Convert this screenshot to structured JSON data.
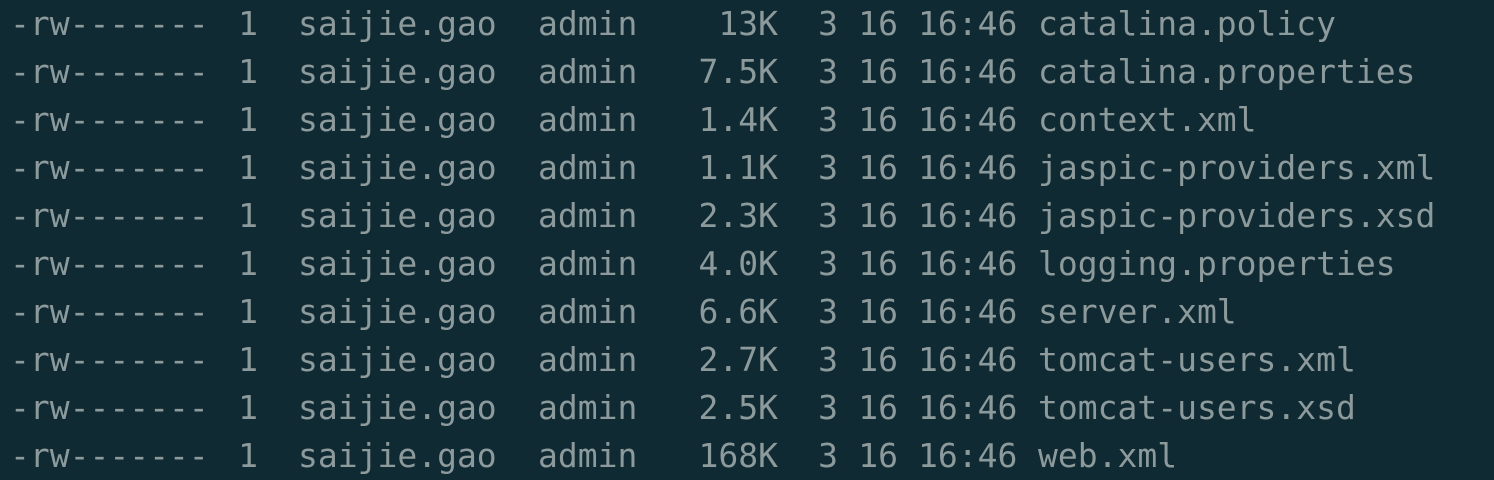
{
  "terminal": {
    "rows": [
      {
        "perm": "-rw-------",
        "links": "1",
        "owner": "saijie.gao",
        "group": "admin",
        "size": "13K",
        "month": "3",
        "day": "16",
        "time": "16:46",
        "name": "catalina.policy"
      },
      {
        "perm": "-rw-------",
        "links": "1",
        "owner": "saijie.gao",
        "group": "admin",
        "size": "7.5K",
        "month": "3",
        "day": "16",
        "time": "16:46",
        "name": "catalina.properties"
      },
      {
        "perm": "-rw-------",
        "links": "1",
        "owner": "saijie.gao",
        "group": "admin",
        "size": "1.4K",
        "month": "3",
        "day": "16",
        "time": "16:46",
        "name": "context.xml"
      },
      {
        "perm": "-rw-------",
        "links": "1",
        "owner": "saijie.gao",
        "group": "admin",
        "size": "1.1K",
        "month": "3",
        "day": "16",
        "time": "16:46",
        "name": "jaspic-providers.xml"
      },
      {
        "perm": "-rw-------",
        "links": "1",
        "owner": "saijie.gao",
        "group": "admin",
        "size": "2.3K",
        "month": "3",
        "day": "16",
        "time": "16:46",
        "name": "jaspic-providers.xsd"
      },
      {
        "perm": "-rw-------",
        "links": "1",
        "owner": "saijie.gao",
        "group": "admin",
        "size": "4.0K",
        "month": "3",
        "day": "16",
        "time": "16:46",
        "name": "logging.properties"
      },
      {
        "perm": "-rw-------",
        "links": "1",
        "owner": "saijie.gao",
        "group": "admin",
        "size": "6.6K",
        "month": "3",
        "day": "16",
        "time": "16:46",
        "name": "server.xml"
      },
      {
        "perm": "-rw-------",
        "links": "1",
        "owner": "saijie.gao",
        "group": "admin",
        "size": "2.7K",
        "month": "3",
        "day": "16",
        "time": "16:46",
        "name": "tomcat-users.xml"
      },
      {
        "perm": "-rw-------",
        "links": "1",
        "owner": "saijie.gao",
        "group": "admin",
        "size": "2.5K",
        "month": "3",
        "day": "16",
        "time": "16:46",
        "name": "tomcat-users.xsd"
      },
      {
        "perm": "-rw-------",
        "links": "1",
        "owner": "saijie.gao",
        "group": "admin",
        "size": "168K",
        "month": "3",
        "day": "16",
        "time": "16:46",
        "name": "web.xml"
      }
    ]
  },
  "colors": {
    "background": "#0f2a33",
    "text": "#8d9a9c"
  }
}
